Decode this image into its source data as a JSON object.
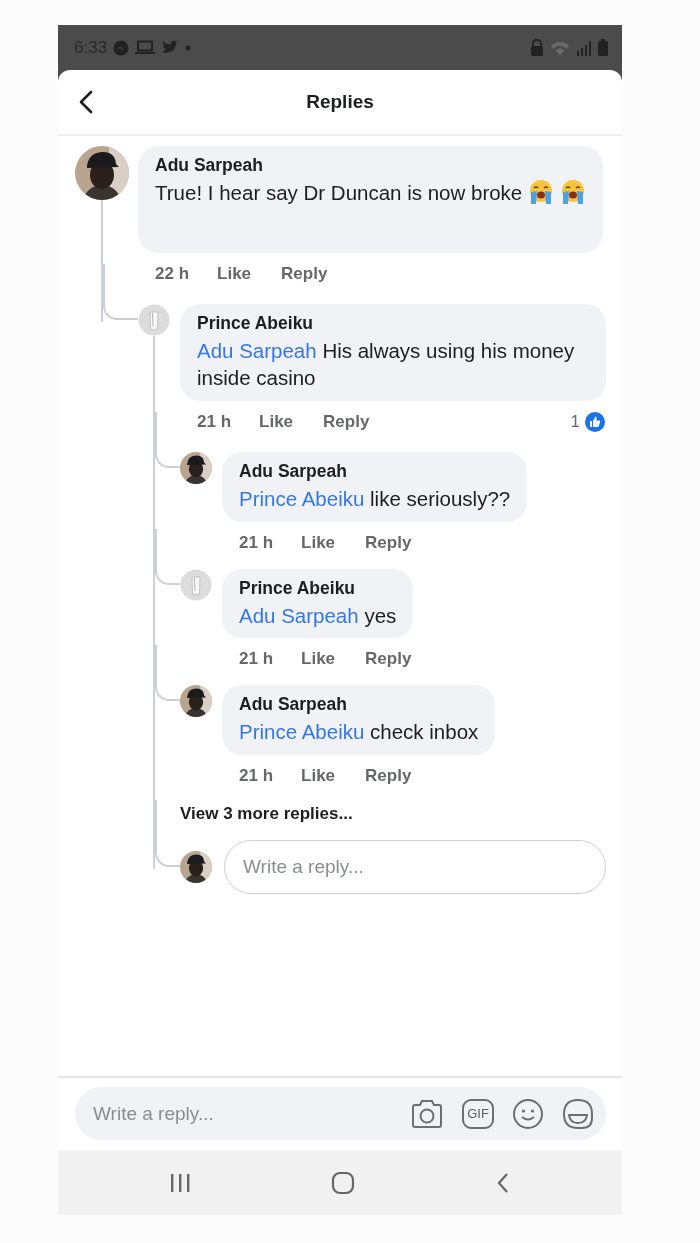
{
  "status_bar": {
    "time": "6:33"
  },
  "header": {
    "title": "Replies"
  },
  "thread": {
    "author": "Adu Sarpeah",
    "avatar": {
      "kind": "photo"
    },
    "text": "True! I hear say Dr Duncan is now broke",
    "emojis": [
      {
        "kind": "crying"
      },
      {
        "kind": "crying"
      }
    ],
    "time": "22 h",
    "actions": [
      "Like",
      "Reply"
    ],
    "replies": [
      {
        "author": "Prince Abeiku",
        "avatar": {
          "kind": "default"
        },
        "mention": "Adu Sarpeah",
        "text": "His always using his money inside casino",
        "time": "21 h",
        "actions": [
          "Like",
          "Reply"
        ],
        "like_count": "1",
        "replies": [
          {
            "author": "Adu Sarpeah",
            "avatar": {
              "kind": "photo"
            },
            "mention": "Prince Abeiku",
            "text": "like seriously??",
            "time": "21 h",
            "actions": [
              "Like",
              "Reply"
            ]
          },
          {
            "author": "Prince Abeiku",
            "avatar": {
              "kind": "default"
            },
            "mention": "Adu Sarpeah",
            "text": "yes",
            "time": "21 h",
            "actions": [
              "Like",
              "Reply"
            ]
          },
          {
            "author": "Adu Sarpeah",
            "avatar": {
              "kind": "photo"
            },
            "mention": "Prince Abeiku",
            "text": "check inbox",
            "time": "21 h",
            "actions": [
              "Like",
              "Reply"
            ]
          }
        ],
        "more_replies": "View 3 more replies...",
        "reply_field": {
          "avatar": {
            "kind": "photo"
          },
          "placeholder": "Write a reply..."
        }
      }
    ]
  },
  "composer": {
    "placeholder": "Write a reply...",
    "gif_label": "GIF"
  }
}
